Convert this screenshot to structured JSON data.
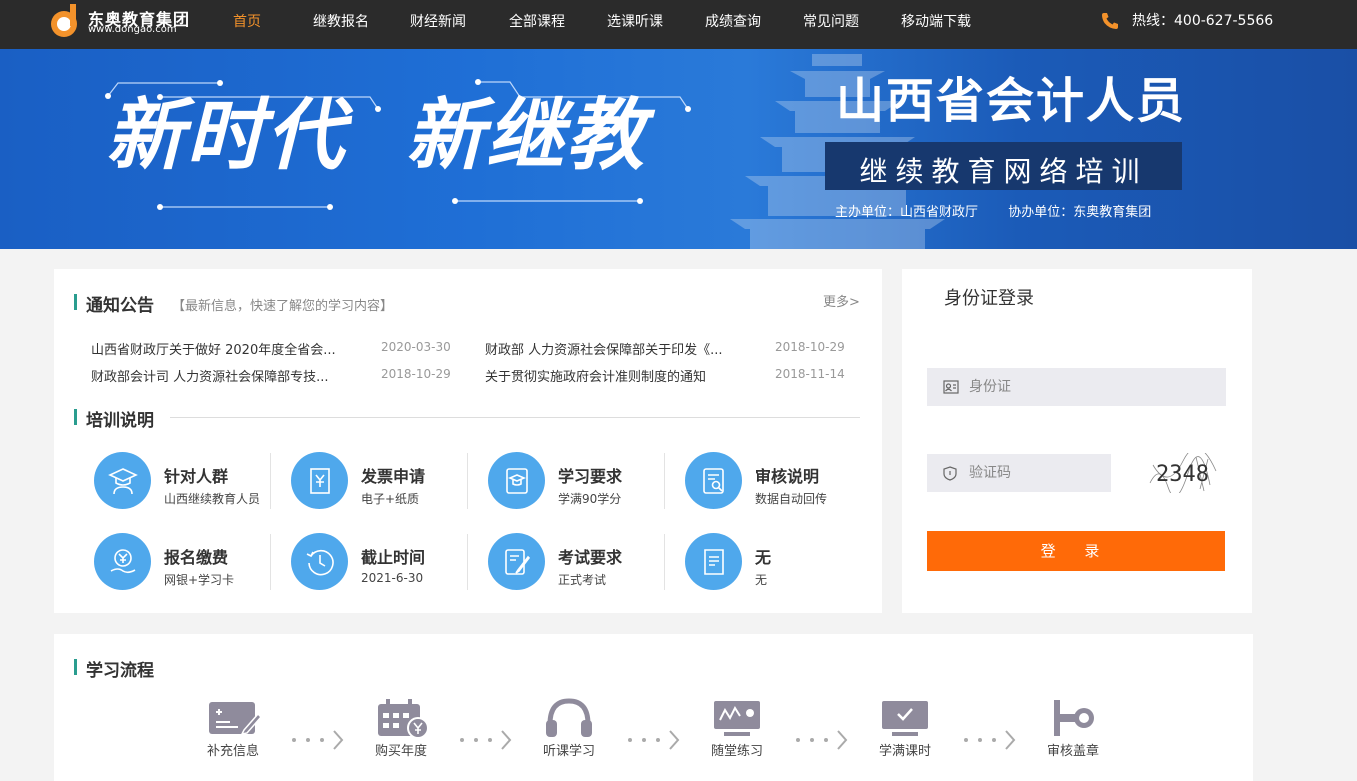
{
  "header": {
    "logo_name": "东奥教育集团",
    "logo_url": "www.dongao.com",
    "nav": [
      "首页",
      "继教报名",
      "财经新闻",
      "全部课程",
      "选课听课",
      "成绩查询",
      "常见问题",
      "移动端下载"
    ],
    "active_nav": "首页",
    "hotline": "热线：400-627-5566"
  },
  "banner": {
    "slogan_left": "新时代",
    "slogan_right": "新继教",
    "title": "山西省会计人员",
    "subtitle": "继续教育网络培训",
    "sponsor": "主办单位：山西省财政厅",
    "co_sponsor": "协办单位：东奥教育集团"
  },
  "notices": {
    "title": "通知公告",
    "subtitle": "【最新信息，快速了解您的学习内容】",
    "more": "更多>",
    "items": [
      {
        "text": "山西省财政厅关于做好 2020年度全省会...",
        "date": "2020-03-30"
      },
      {
        "text": "财政部 人力资源社会保障部关于印发《...",
        "date": "2018-10-29"
      },
      {
        "text": "财政部会计司 人力资源社会保障部专技...",
        "date": "2018-10-29"
      },
      {
        "text": "关于贯彻实施政府会计准则制度的通知",
        "date": "2018-11-14"
      }
    ]
  },
  "training": {
    "title": "培训说明",
    "items": [
      {
        "title": "针对人群",
        "desc": "山西继续教育人员",
        "icon": "student-icon"
      },
      {
        "title": "发票申请",
        "desc": "电子+纸质",
        "icon": "invoice-icon"
      },
      {
        "title": "学习要求",
        "desc": "学满90学分",
        "icon": "book-icon"
      },
      {
        "title": "审核说明",
        "desc": "数据自动回传",
        "icon": "audit-doc-icon"
      },
      {
        "title": "报名缴费",
        "desc": "网银+学习卡",
        "icon": "payment-icon"
      },
      {
        "title": "截止时间",
        "desc": "2021-6-30",
        "icon": "clock-icon"
      },
      {
        "title": "考试要求",
        "desc": "正式考试",
        "icon": "exam-icon"
      },
      {
        "title": "无",
        "desc": "无",
        "icon": "document-icon"
      }
    ]
  },
  "login": {
    "title": "身份证登录",
    "id_placeholder": "身份证",
    "captcha_placeholder": "验证码",
    "captcha_text": "2348",
    "button": "登 录"
  },
  "process": {
    "title": "学习流程",
    "steps": [
      "补充信息",
      "购买年度",
      "听课学习",
      "随堂练习",
      "学满课时",
      "审核盖章"
    ]
  },
  "colors": {
    "header_bg": "#2b2b2b",
    "nav_active": "#f3922b",
    "accent_orange": "#ff6a08",
    "icon_blue": "#4fa8ec",
    "section_bar": "#2a9d8f",
    "step_gray": "#8f8b9c"
  }
}
